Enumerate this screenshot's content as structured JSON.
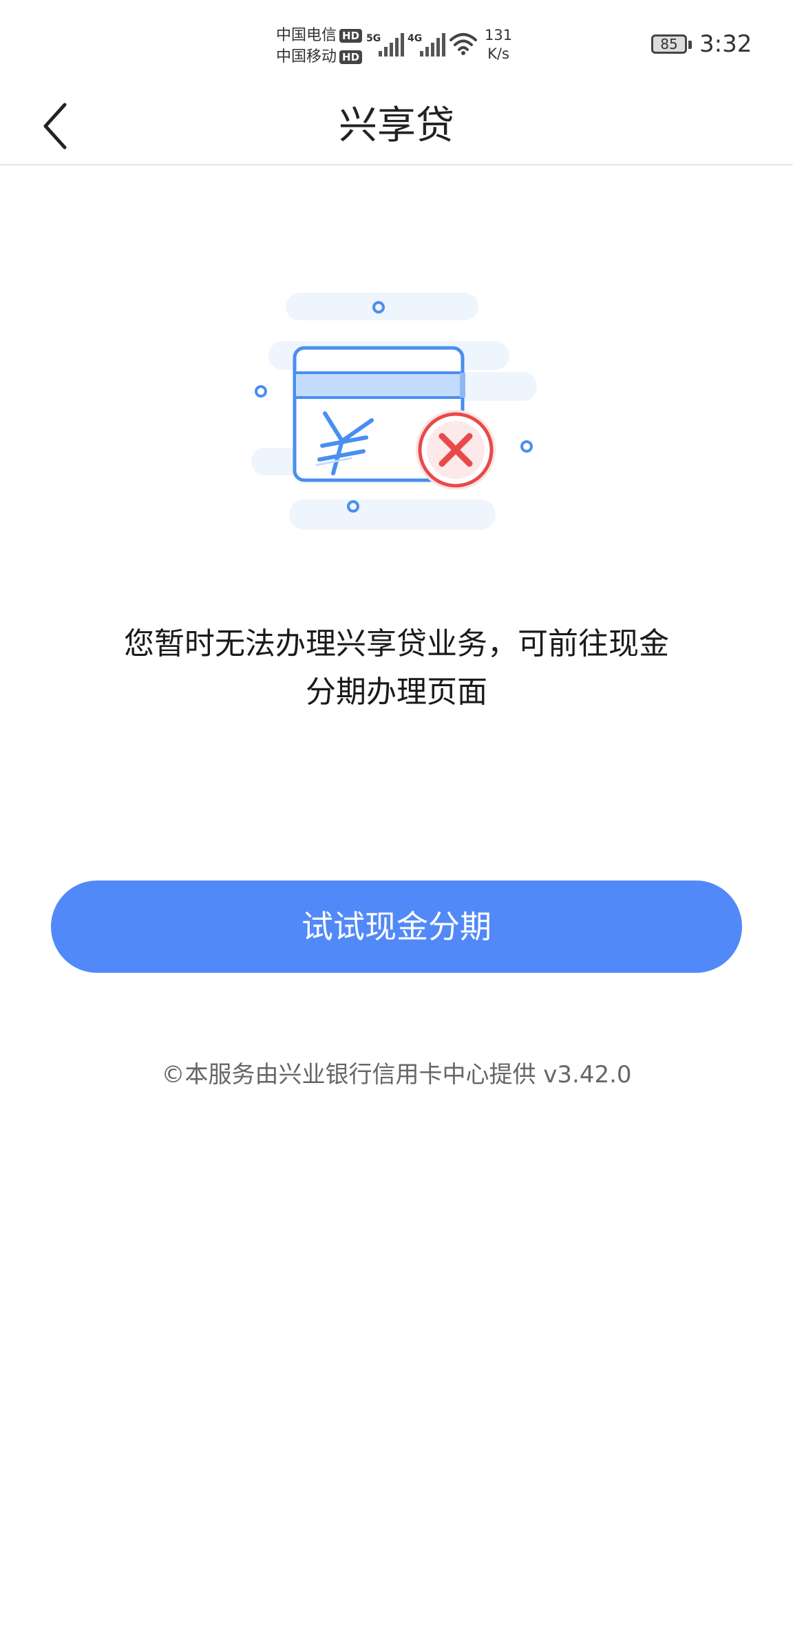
{
  "status_bar": {
    "carrier_1": "中国电信",
    "carrier_2": "中国移动",
    "hd_badge": "HD",
    "network_1": "5G",
    "network_2": "4G",
    "speed_value": "131",
    "speed_unit": "K/s",
    "battery_level": "85",
    "time": "3:32"
  },
  "nav": {
    "title": "兴享贷",
    "back_icon": "chevron-left-icon"
  },
  "illustration": {
    "icon": "credit-card-error-icon",
    "accent_color": "#4a8ef0",
    "error_color": "#e84a4a"
  },
  "message": {
    "line_1": "您暂时无法办理兴享贷业务，可前往现金",
    "line_2": "分期办理页面"
  },
  "actions": {
    "primary_label": "试试现金分期",
    "primary_color": "#5289f8"
  },
  "footer": {
    "copyright": "©本服务由兴业银行信用卡中心提供 v3.42.0"
  }
}
